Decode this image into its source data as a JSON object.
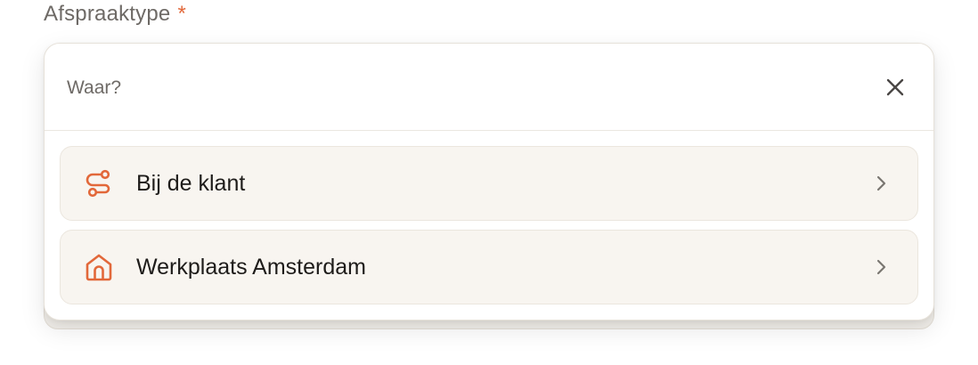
{
  "field": {
    "label": "Afspraaktype",
    "required_mark": "*"
  },
  "popup": {
    "title": "Waar?",
    "close_icon": "close-icon",
    "options": [
      {
        "label": "Bij de klant",
        "icon": "route-icon"
      },
      {
        "label": "Werkplaats Amsterdam",
        "icon": "home-icon"
      }
    ]
  },
  "colors": {
    "accent": "#e2683a",
    "option_bg": "#f8f5f0",
    "text": "#1e1c1a",
    "muted": "#6e6a66"
  }
}
